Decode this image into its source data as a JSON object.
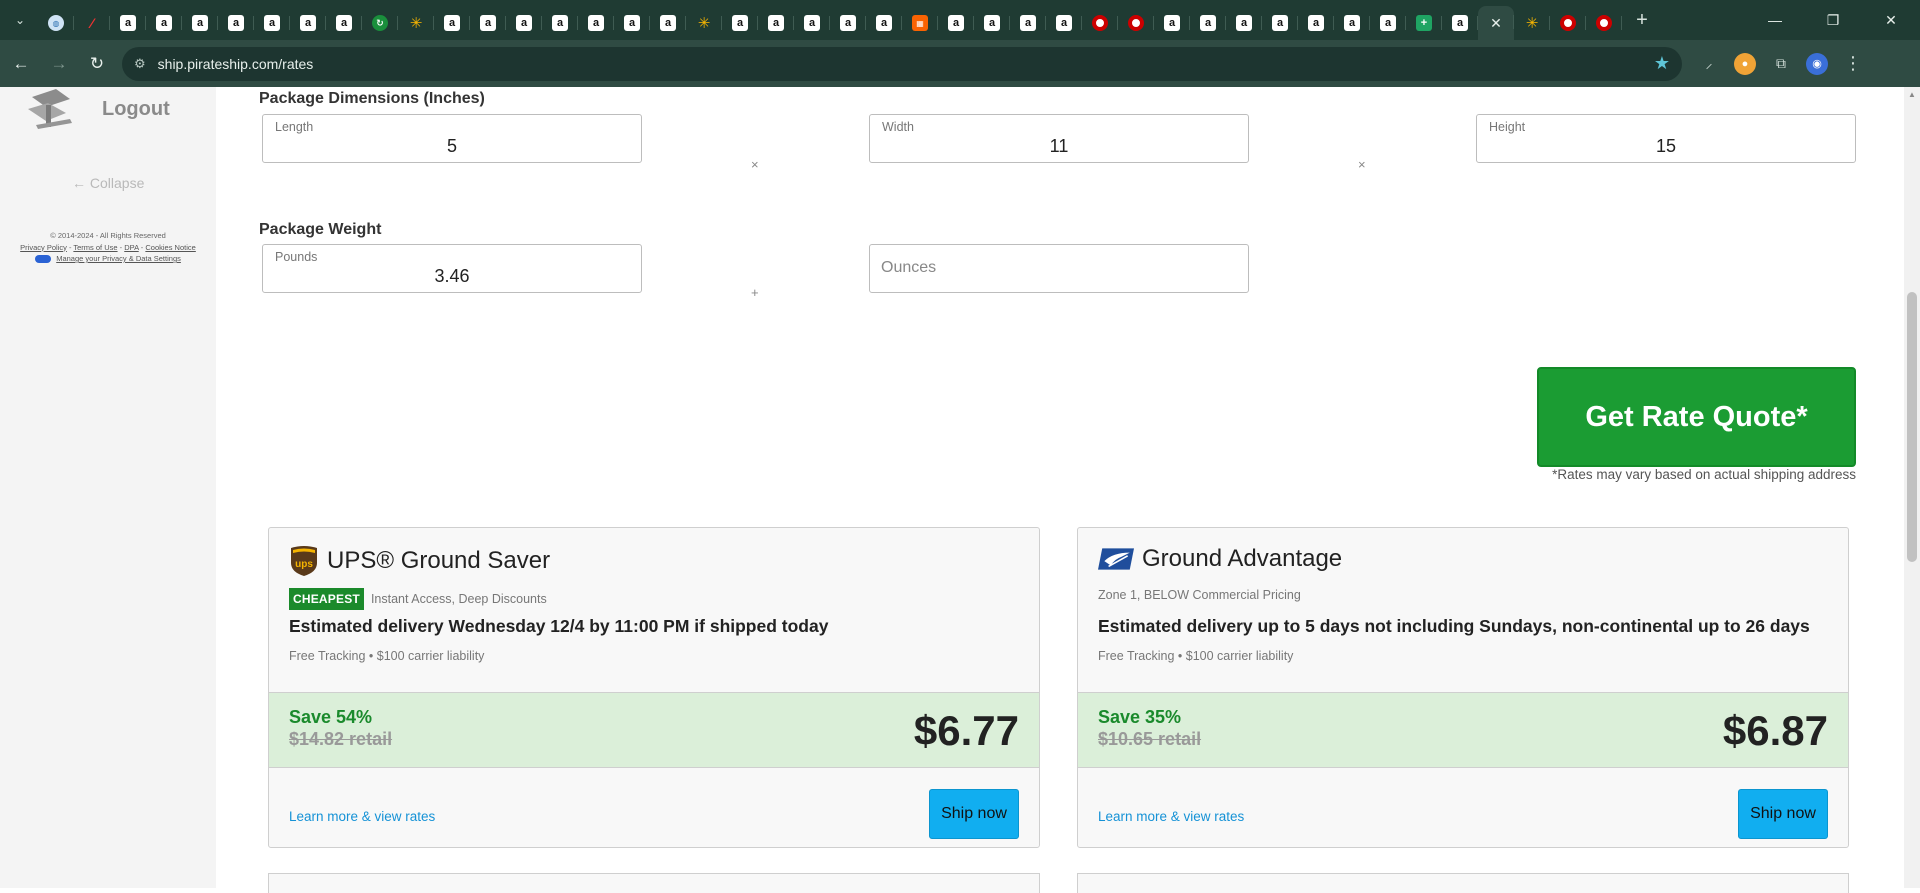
{
  "browser": {
    "tabs": [
      {
        "icon": "globe-icon",
        "glyph": "◍"
      },
      {
        "icon": "slash-icon",
        "glyph": "⁄"
      },
      {
        "icon": "amazon-icon",
        "glyph": "a"
      },
      {
        "icon": "amazon-icon",
        "glyph": "a"
      },
      {
        "icon": "amazon-icon",
        "glyph": "a"
      },
      {
        "icon": "amazon-icon",
        "glyph": "a"
      },
      {
        "icon": "amazon-icon",
        "glyph": "a"
      },
      {
        "icon": "amazon-icon",
        "glyph": "a"
      },
      {
        "icon": "amazon-icon",
        "glyph": "a"
      },
      {
        "icon": "green-circle-icon",
        "glyph": "↻"
      },
      {
        "icon": "walmart-icon",
        "glyph": "✳"
      },
      {
        "icon": "amazon-icon",
        "glyph": "a"
      },
      {
        "icon": "amazon-icon",
        "glyph": "a"
      },
      {
        "icon": "amazon-icon",
        "glyph": "a"
      },
      {
        "icon": "amazon-icon",
        "glyph": "a"
      },
      {
        "icon": "amazon-icon",
        "glyph": "a"
      },
      {
        "icon": "amazon-icon",
        "glyph": "a"
      },
      {
        "icon": "amazon-icon",
        "glyph": "a"
      },
      {
        "icon": "walmart-icon",
        "glyph": "✳"
      },
      {
        "icon": "amazon-icon",
        "glyph": "a"
      },
      {
        "icon": "amazon-icon",
        "glyph": "a"
      },
      {
        "icon": "amazon-icon",
        "glyph": "a"
      },
      {
        "icon": "amazon-icon",
        "glyph": "a"
      },
      {
        "icon": "amazon-icon",
        "glyph": "a"
      },
      {
        "icon": "home-depot-icon",
        "glyph": "▦"
      },
      {
        "icon": "amazon-icon",
        "glyph": "a"
      },
      {
        "icon": "amazon-icon",
        "glyph": "a"
      },
      {
        "icon": "amazon-icon",
        "glyph": "a"
      },
      {
        "icon": "amazon-icon",
        "glyph": "a"
      },
      {
        "icon": "target-icon",
        "glyph": ""
      },
      {
        "icon": "target-icon",
        "glyph": ""
      },
      {
        "icon": "amazon-icon",
        "glyph": "a"
      },
      {
        "icon": "amazon-icon",
        "glyph": "a"
      },
      {
        "icon": "amazon-icon",
        "glyph": "a"
      },
      {
        "icon": "amazon-icon",
        "glyph": "a"
      },
      {
        "icon": "amazon-icon",
        "glyph": "a"
      },
      {
        "icon": "amazon-icon",
        "glyph": "a"
      },
      {
        "icon": "amazon-icon",
        "glyph": "a"
      },
      {
        "icon": "sheets-icon",
        "glyph": "+"
      },
      {
        "icon": "amazon-icon",
        "glyph": "a"
      },
      {
        "icon": "close-icon",
        "glyph": "✕",
        "active": true
      },
      {
        "icon": "walmart-icon",
        "glyph": "✳"
      },
      {
        "icon": "target-icon",
        "glyph": ""
      },
      {
        "icon": "target-icon",
        "glyph": ""
      }
    ],
    "url": "ship.pirateship.com/rates"
  },
  "sidebar": {
    "logout_label": "Logout",
    "collapse_label": "← Collapse",
    "legal": {
      "copyright": "© 2014-2024 - All Rights Reserved",
      "privacy_policy": "Privacy Policy",
      "terms": "Terms of Use",
      "dpa": "DPA",
      "cookies": "Cookies Notice",
      "manage_privacy": "Manage your Privacy & Data Settings"
    }
  },
  "form": {
    "dimensions_label": "Package Dimensions (Inches)",
    "length": {
      "label": "Length",
      "value": "5"
    },
    "width": {
      "label": "Width",
      "value": "11"
    },
    "height": {
      "label": "Height",
      "value": "15"
    },
    "times_symbol": "×",
    "weight_label": "Package Weight",
    "pounds": {
      "label": "Pounds",
      "value": "3.46"
    },
    "plus_symbol": "+",
    "ounces": {
      "placeholder": "Ounces"
    },
    "quote_button": "Get Rate Quote*",
    "quote_note": "*Rates may vary based on actual shipping address"
  },
  "rates": [
    {
      "carrier_icon": "ups-logo-icon",
      "title": "UPS® Ground Saver",
      "badge": "CHEAPEST",
      "subtitle": "Instant Access, Deep Discounts",
      "delivery": "Estimated delivery Wednesday 12/4 by 11:00 PM if shipped today",
      "extras": "Free Tracking • $100 carrier liability",
      "save": "Save 54%",
      "retail": "$14.82 retail",
      "price": "$6.77",
      "learn_more": "Learn more & view rates",
      "ship_now": "Ship now"
    },
    {
      "carrier_icon": "usps-eagle-icon",
      "title": "Ground Advantage",
      "badge": "",
      "subtitle": "Zone 1, BELOW Commercial Pricing",
      "delivery": "Estimated delivery up to 5 days not including Sundays, non-continental up to 26 days",
      "extras": "Free Tracking • $100 carrier liability",
      "save": "Save 35%",
      "retail": "$10.65 retail",
      "price": "$6.87",
      "learn_more": "Learn more & view rates",
      "ship_now": "Ship now"
    }
  ],
  "colors": {
    "browser_frame": "#1f3b33",
    "quote_button": "#1b9c33",
    "savings_band": "#dbefd9",
    "savings_text": "#1a8a2c",
    "ship_button": "#11aef0",
    "link": "#1592d6"
  }
}
